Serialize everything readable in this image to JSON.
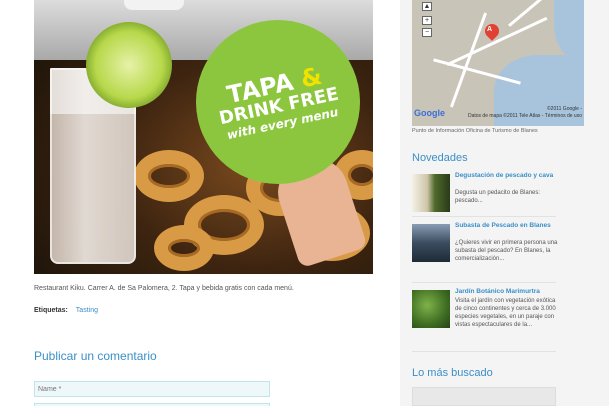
{
  "post": {
    "image_sign": {
      "line1": "TAPA",
      "amp": "&",
      "line2": "DRINK FREE",
      "line3": "with every menu"
    },
    "caption": "Restaurant Kiku. Carrer A. de Sa Palomera, 2. Tapa y bebida gratis con cada menú.",
    "tags_label": "Etiquetas:",
    "tags_value": "Tasting"
  },
  "comment_form": {
    "title": "Publicar un comentario",
    "name_placeholder": "Name *"
  },
  "sidebar": {
    "map": {
      "zoom_in": "+",
      "zoom_out": "−",
      "marker_letter": "A",
      "google_logo": "Google",
      "copyright": "©2011 Google -",
      "terms": "Datos de mapa ©2011 Tele Atlas - Términos de uso",
      "caption": "Punto de Información Oficina de Turismo de Blanes"
    },
    "novedades_title": "Novedades",
    "items": [
      {
        "title": "Degustación de pescado y cava",
        "desc": "Degusta un pedacito de Blanes: pescado..."
      },
      {
        "title": "Subasta de Pescado en Blanes",
        "desc": "¿Quieres vivir en primera persona una subasta del pescado? En Blanes, la comercialización..."
      },
      {
        "title": "Jardín Botánico Marimurtra",
        "desc": "Visita el jardín con vegetación exótica de cinco continentes y cerca de 3.000 especies vegetales, en un paraje con vistas espectaculares de la..."
      }
    ],
    "most_searched_title": "Lo más buscado"
  }
}
